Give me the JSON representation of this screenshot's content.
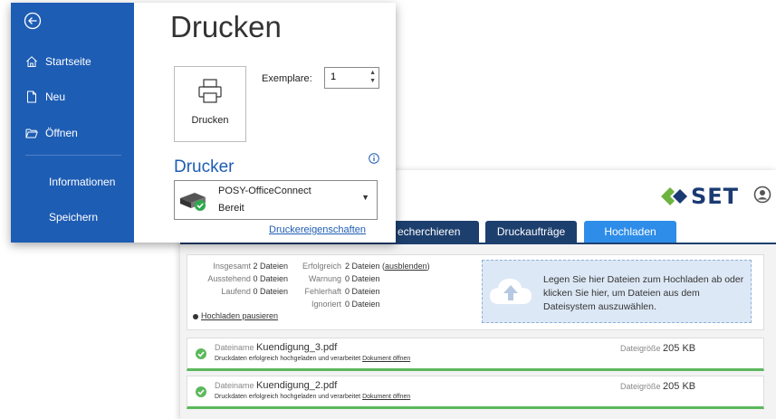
{
  "word": {
    "title": "Drucken",
    "nav": {
      "start": "Startseite",
      "new": "Neu",
      "open": "Öffnen",
      "info": "Informationen",
      "save": "Speichern"
    },
    "print_button": "Drucken",
    "copies_label": "Exemplare:",
    "copies_value": "1",
    "printer_heading": "Drucker",
    "printer_name": "POSY-OfficeConnect",
    "printer_status": "Bereit",
    "printer_properties_link": "Druckereigenschaften"
  },
  "set": {
    "logo": "SET",
    "tabs": [
      "echerchieren",
      "Druckaufträge",
      "Hochladen"
    ],
    "active_tab": "Hochladen",
    "stats": {
      "total_label": "Insgesamt",
      "total_value": "2 Dateien",
      "pending_label": "Ausstehend",
      "pending_value": "0 Dateien",
      "running_label": "Laufend",
      "running_value": "0 Dateien",
      "success_label": "Erfolgreich",
      "success_value": "2 Dateien",
      "hide_link": "ausblenden",
      "warning_label": "Warnung",
      "warning_value": "0 Dateien",
      "error_label": "Fehlerhaft",
      "error_value": "0 Dateien",
      "ignored_label": "Ignoriert",
      "ignored_value": "0 Dateien"
    },
    "pause_link": "Hochladen pausieren",
    "dropzone_text": "Legen Sie hier Dateien zum Hochladen ab oder klicken Sie hier, um Dateien aus dem Dateisystem auszuwählen.",
    "files": [
      {
        "name_label": "Dateiname",
        "name": "Kuendigung_3.pdf",
        "status": "Druckdaten erfolgreich hochgeladen und verarbeitet",
        "open_link": "Dokument öffnen",
        "size_label": "Dateigröße",
        "size": "205 KB"
      },
      {
        "name_label": "Dateiname",
        "name": "Kuendigung_2.pdf",
        "status": "Druckdaten erfolgreich hochgeladen und verarbeitet",
        "open_link": "Dokument öffnen",
        "size_label": "Dateigröße",
        "size": "205 KB"
      }
    ],
    "colors": {
      "navy": "#1d3f6e",
      "active_tab": "#2e8de8",
      "success": "#5cb85c",
      "logo_green": "#6db33f"
    }
  },
  "icons": [
    "back-arrow-icon",
    "home-icon",
    "new-document-icon",
    "open-folder-icon",
    "printer-icon",
    "info-icon",
    "printer-status-icon",
    "dropdown-caret-icon",
    "spinner-arrows-icon",
    "set-logo-icon",
    "user-icon",
    "cloud-upload-icon",
    "check-circle-icon",
    "pause-icon"
  ]
}
